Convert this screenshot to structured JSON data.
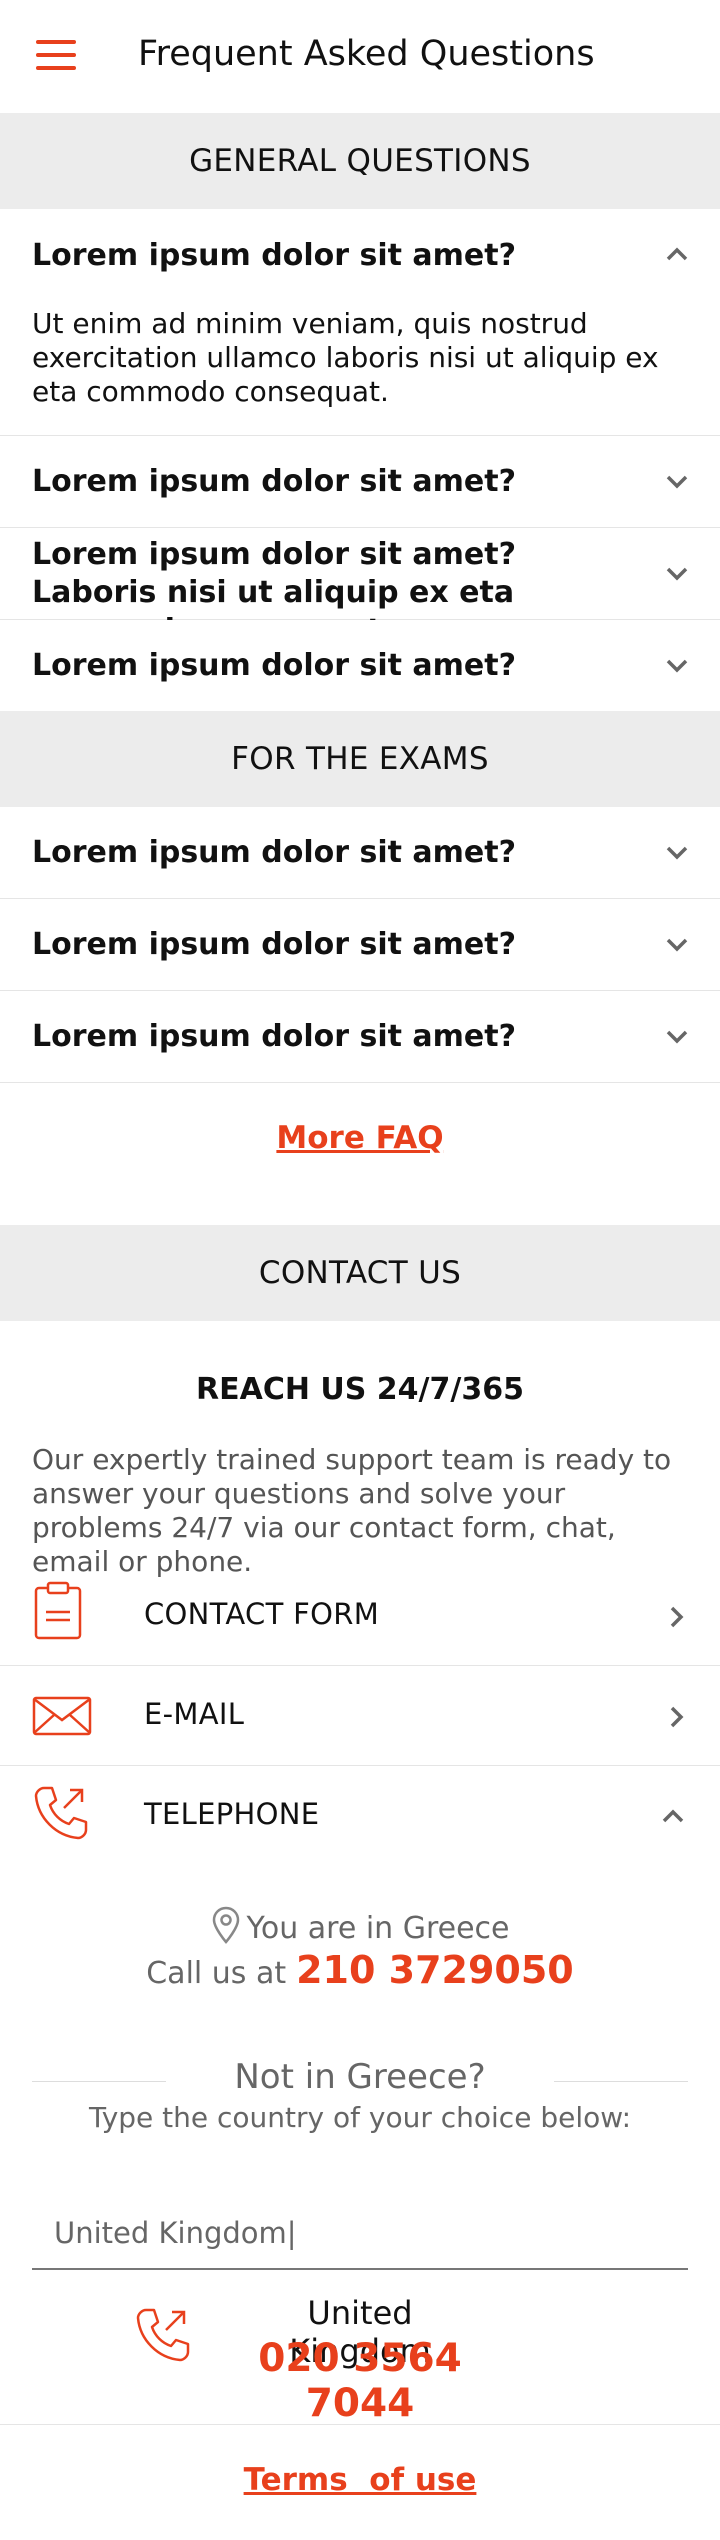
{
  "header": {
    "title": "Frequent Asked Questions",
    "menu_icon": "hamburger-menu-icon"
  },
  "accent_color": "#e8401c",
  "general": {
    "heading": "GENERAL QUESTIONS",
    "items": [
      {
        "question": "Lorem ipsum dolor sit amet?",
        "answer": "Ut enim ad minim veniam, quis nostrud exercitation ullamco laboris nisi ut aliquip ex eta commodo consequat.",
        "expanded": true
      },
      {
        "question": "Lorem ipsum dolor sit amet?",
        "expanded": false
      },
      {
        "question": "Lorem ipsum dolor sit amet? Laboris nisi ut aliquip ex eta commodo consequat",
        "expanded": false
      },
      {
        "question": "Lorem ipsum dolor sit amet?",
        "expanded": false
      }
    ]
  },
  "exams": {
    "heading": "FOR THE EXAMS",
    "items": [
      {
        "question": "Lorem ipsum dolor sit amet?",
        "expanded": false
      },
      {
        "question": "Lorem ipsum dolor sit amet?",
        "expanded": false
      },
      {
        "question": "Lorem ipsum dolor sit amet?",
        "expanded": false
      }
    ]
  },
  "more_faq_label": "More FAQ",
  "contact": {
    "heading": "CONTACT US",
    "reach_title": "REACH US 24/7/365",
    "reach_text": "Our expertly trained support team is ready to answer your questions and solve your problems 24/7 via our contact form, chat, email or phone.",
    "options": [
      {
        "label": "CONTACT FORM",
        "icon": "clipboard-icon",
        "expanded": false
      },
      {
        "label": "E-MAIL",
        "icon": "envelope-icon",
        "expanded": false
      },
      {
        "label": "TELEPHONE",
        "icon": "phone-icon",
        "expanded": true
      }
    ],
    "location_text": "You are in Greece",
    "call_prefix": "Call us at",
    "phone_number": "210 3729050",
    "not_in_country": "Not in Greece?",
    "type_country": "Type the country of your choice below:",
    "country_input_value": "United Kingdom|",
    "result_country": "United Kingdom",
    "result_number": "020 3564 7044"
  },
  "terms_label": "Terms  of use"
}
